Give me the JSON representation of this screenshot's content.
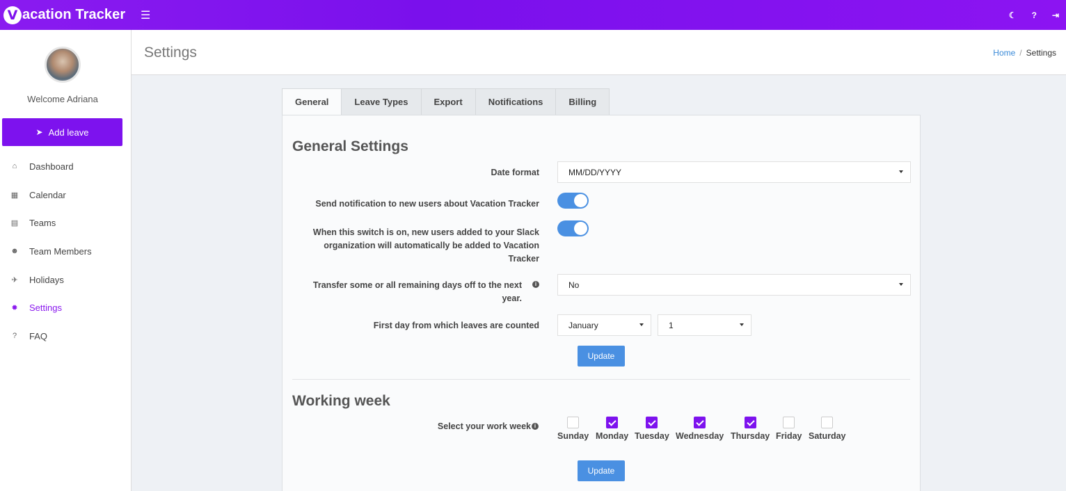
{
  "app": {
    "logo_letter": "V",
    "name_rest": "acation Tracker"
  },
  "topbar": {
    "menu_icon": "☰",
    "moon_icon": "☾",
    "help_icon": "?",
    "logout_icon": "⇥"
  },
  "sidebar": {
    "welcome": "Welcome Adriana",
    "add_leave": "Add leave",
    "items": [
      {
        "label": "Dashboard",
        "icon": "⌂"
      },
      {
        "label": "Calendar",
        "icon": "▦"
      },
      {
        "label": "Teams",
        "icon": "▤"
      },
      {
        "label": "Team Members",
        "icon": "☻"
      },
      {
        "label": "Holidays",
        "icon": "✈"
      },
      {
        "label": "Settings",
        "icon": "✹"
      },
      {
        "label": "FAQ",
        "icon": "?"
      }
    ],
    "active_item": "Settings"
  },
  "header": {
    "title": "Settings",
    "breadcrumb_home": "Home",
    "breadcrumb_sep": "/",
    "breadcrumb_current": "Settings"
  },
  "tabs": [
    "General",
    "Leave Types",
    "Export",
    "Notifications",
    "Billing"
  ],
  "active_tab": "General",
  "general": {
    "heading": "General Settings",
    "date_format_label": "Date format",
    "date_format_value": "MM/DD/YYYY",
    "notify_label": "Send notification to new users about Vacation Tracker",
    "notify_on": true,
    "auto_add_label": "When this switch is on, new users added to your Slack organization will automatically be added to Vacation Tracker",
    "auto_add_on": true,
    "transfer_label": "Transfer some or all remaining days off to the next year.",
    "transfer_value": "No",
    "first_day_label": "First day from which leaves are counted",
    "first_day_month": "January",
    "first_day_day": "1",
    "update_label": "Update"
  },
  "working_week": {
    "heading": "Working week",
    "select_label": "Select your work week",
    "days": [
      {
        "name": "Sunday",
        "checked": false
      },
      {
        "name": "Monday",
        "checked": true
      },
      {
        "name": "Tuesday",
        "checked": true
      },
      {
        "name": "Wednesday",
        "checked": true
      },
      {
        "name": "Thursday",
        "checked": true
      },
      {
        "name": "Friday",
        "checked": false
      },
      {
        "name": "Saturday",
        "checked": false
      }
    ],
    "update_label": "Update"
  },
  "colors": {
    "brand": "#7d12ee",
    "accent_blue": "#4a90e2"
  }
}
